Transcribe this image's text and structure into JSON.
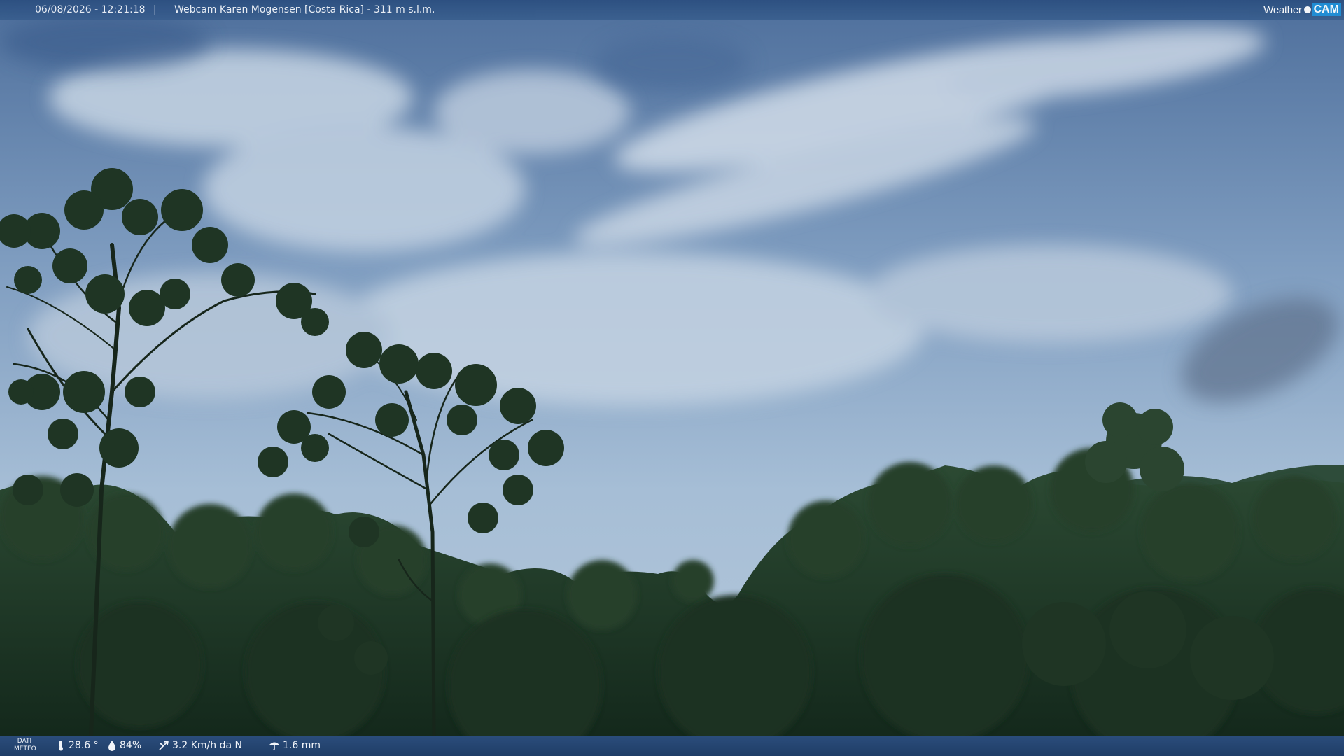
{
  "overlay": {
    "datetime": "06/08/2026 - 12:21:18",
    "separator": "|",
    "title": "Webcam Karen Mogensen [Costa Rica] - 311 m s.l.m.",
    "brand_weather": "Weather",
    "brand_cam": "CAM"
  },
  "weather": {
    "label_line1": "DATI",
    "label_line2": "METEO",
    "temperature": "28.6 °",
    "humidity": "84%",
    "wind": "3.2 Km/h da N",
    "rain": "1.6 mm"
  },
  "icons": {
    "temperature": "thermometer-icon",
    "humidity": "humidity-icon",
    "wind": "wind-icon",
    "rain": "rain-icon"
  },
  "colors": {
    "bar": "#2c4f80",
    "sky": "#6f8fb4",
    "forest": "#1f3a24",
    "brand_accent": "#1e8fd8"
  }
}
